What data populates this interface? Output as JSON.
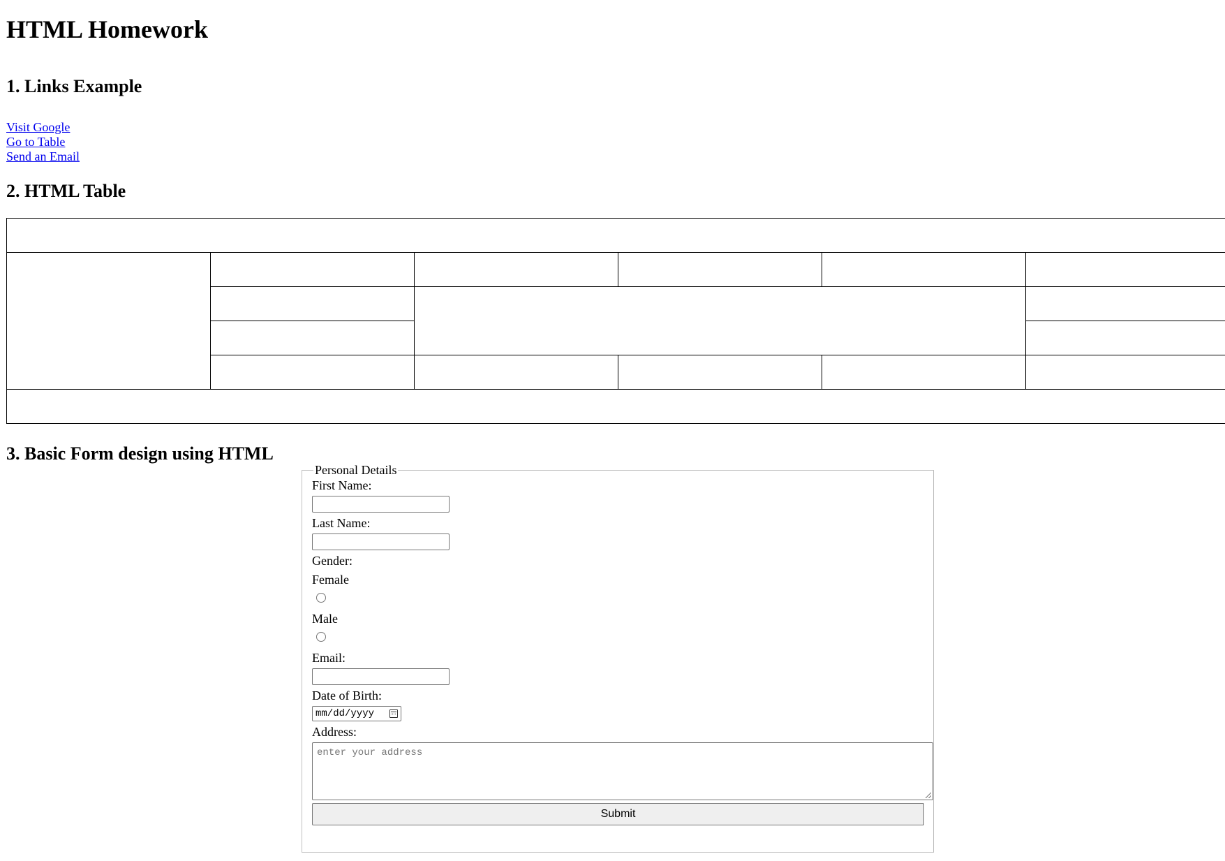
{
  "page": {
    "title": "HTML Homework"
  },
  "links_section": {
    "heading": "1. Links Example",
    "links": [
      {
        "label": "Visit Google"
      },
      {
        "label": "Go to Table"
      },
      {
        "label": "Send an Email"
      }
    ]
  },
  "table_section": {
    "heading": "2. HTML Table"
  },
  "form_section": {
    "heading": "3. Basic Form design using HTML",
    "legend": "Personal Details",
    "first_name_label": "First Name:",
    "last_name_label": "Last Name:",
    "gender_label": "Gender:",
    "gender_options": [
      {
        "label": "Female"
      },
      {
        "label": "Male"
      }
    ],
    "email_label": "Email:",
    "dob_label": "Date of Birth:",
    "dob_placeholder": "mm/dd/yyyy",
    "address_label": "Address:",
    "address_placeholder": "enter your address",
    "submit_label": "Submit"
  },
  "icons": {
    "calendar": "calendar-icon",
    "resize": "resize-handle-icon"
  },
  "colors": {
    "link": "#0000ee",
    "fieldset_border": "#c0c0c0",
    "button_bg": "#efefef"
  }
}
